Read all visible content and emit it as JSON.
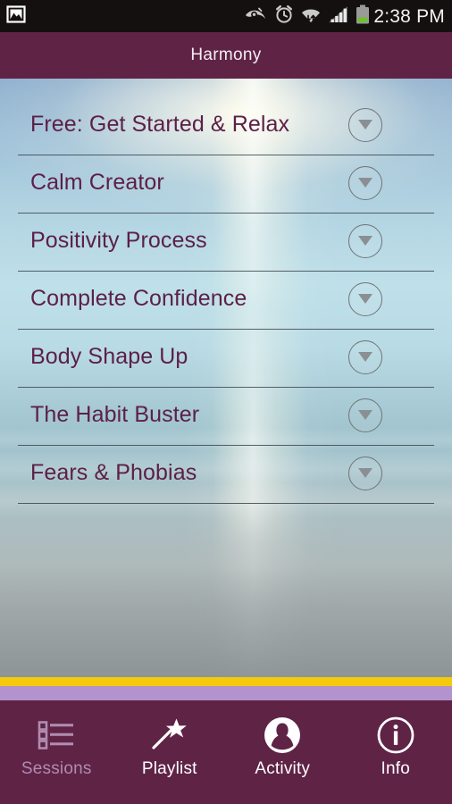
{
  "status_bar": {
    "time": "2:38 PM",
    "left_icons": [
      {
        "name": "gallery-icon",
        "label": "Gallery"
      }
    ],
    "right_icons": [
      {
        "name": "eye-icon",
        "label": "Smart stay"
      },
      {
        "name": "alarm-clock-icon",
        "label": "Alarm set"
      },
      {
        "name": "wifi-icon",
        "label": "Wi-Fi connected"
      },
      {
        "name": "cellular-signal-icon",
        "label": "Signal strength"
      },
      {
        "name": "battery-icon",
        "label": "Battery"
      }
    ]
  },
  "title_bar": {
    "title": "Harmony"
  },
  "session_list": {
    "items": [
      {
        "label": "Free: Get Started & Relax",
        "toggle": "expand-chevron"
      },
      {
        "label": "Calm Creator",
        "toggle": "expand-chevron"
      },
      {
        "label": "Positivity Process",
        "toggle": "expand-chevron"
      },
      {
        "label": "Complete Confidence",
        "toggle": "expand-chevron"
      },
      {
        "label": "Body Shape Up",
        "toggle": "expand-chevron"
      },
      {
        "label": "The Habit Buster",
        "toggle": "expand-chevron"
      },
      {
        "label": "Fears & Phobias",
        "toggle": "expand-chevron"
      }
    ]
  },
  "bottom_nav": {
    "items": [
      {
        "label": "Sessions",
        "icon": "checklist-icon",
        "state": "dim"
      },
      {
        "label": "Playlist",
        "icon": "magic-wand-icon",
        "state": "normal"
      },
      {
        "label": "Activity",
        "icon": "person-circle-icon",
        "state": "normal"
      },
      {
        "label": "Info",
        "icon": "info-circle-icon",
        "state": "normal"
      }
    ]
  },
  "colors": {
    "brand_maroon": "#5F2346",
    "accent_gold": "#F5C90D",
    "accent_lilac": "#B293CD",
    "list_text": "#5C2048",
    "status_bar_bg": "#14100F",
    "nav_dim_text": "#B08CB0"
  }
}
